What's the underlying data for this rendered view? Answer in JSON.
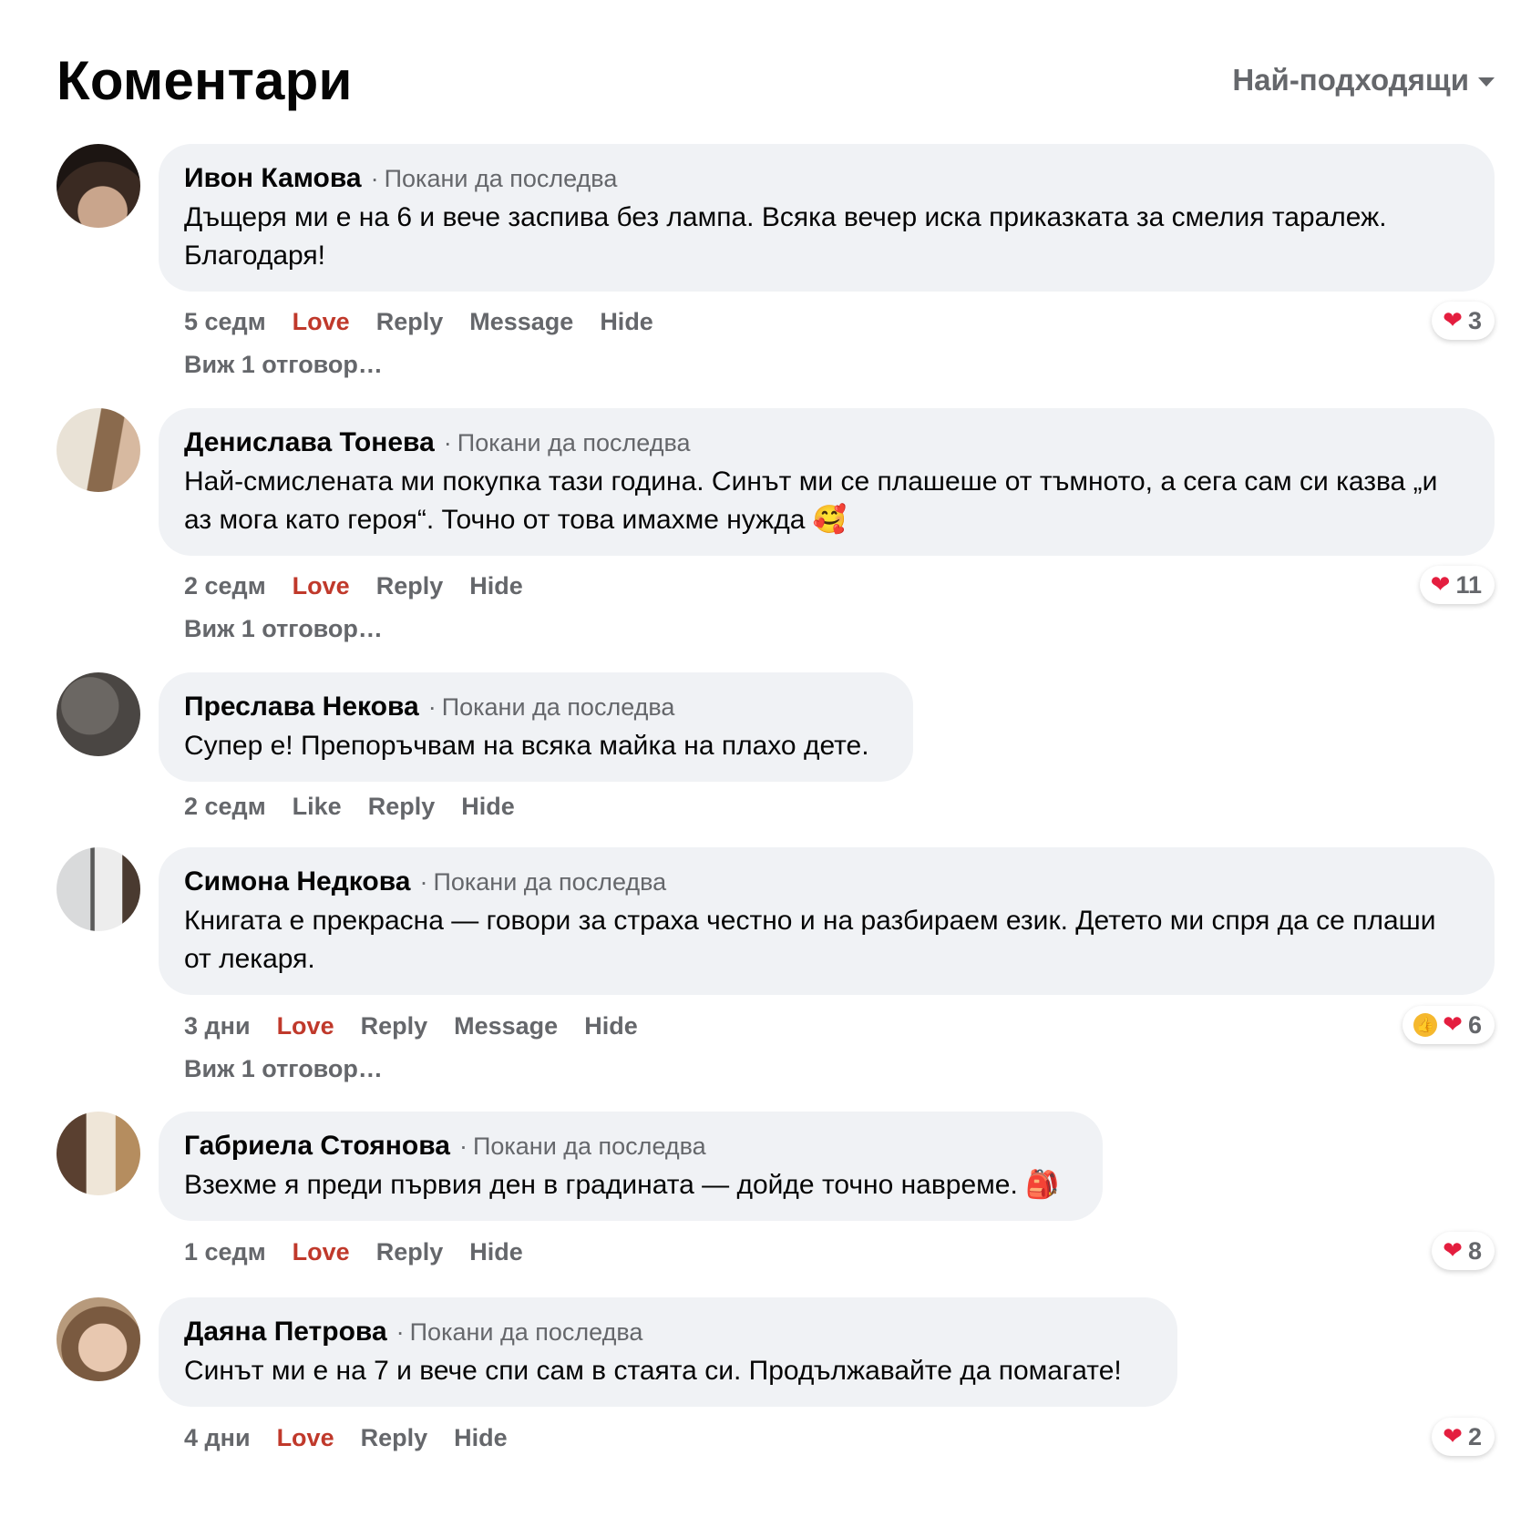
{
  "header": {
    "title": "Коментари",
    "sort_label": "Най-подходящи"
  },
  "comments": [
    {
      "name": "Ивон Камова",
      "invite": "Покани да последва",
      "text": "Дъщеря ми е на 6 и вече заспива без лампа. Всяка вечер иска приказката за смелия таралеж. Благодаря!",
      "time": "5 седм",
      "actions": [
        "Love",
        "Reply",
        "Message",
        "Hide"
      ],
      "replies": "Виж 1 отговор…",
      "reaction_count": "3"
    },
    {
      "name": "Денислава Тонева",
      "invite": "Покани да последва",
      "text": "Най-смислената ми покупка тази година. Синът ми се плашеше от тъмното, а сега сам си казва „и аз мога като героя“. Точно от това имахме нужда",
      "emoji": "🥰",
      "time": "2 седм",
      "actions": [
        "Love",
        "Reply",
        "Hide"
      ],
      "replies": "Виж 1 отговор…",
      "reaction_count": "11"
    },
    {
      "name": "Преслава Некова",
      "invite": "Покани да последва",
      "text": "Супер е! Препоръчвам на всяка майка на плахо дете.",
      "time": "2 седм",
      "actions": [
        "Like",
        "Reply",
        "Hide"
      ]
    },
    {
      "name": "Симона Недкова",
      "invite": "Покани да последва",
      "text": "Книгата е прекрасна — говори за страха честно и на разбираем език. Детето ми спря да се плаши от лекаря.",
      "time": "3 дни",
      "actions": [
        "Love",
        "Reply",
        "Message",
        "Hide"
      ],
      "replies": "Виж 1 отговор…",
      "reaction_count": "6"
    },
    {
      "name": "Габриела Стоянова",
      "invite": "Покани да последва",
      "text": "Взехме я преди първия ден в градината — дойде точно навреме.",
      "emoji": "🎒",
      "time": "1 седм",
      "actions": [
        "Love",
        "Reply",
        "Hide"
      ],
      "reaction_count": "8"
    },
    {
      "name": "Даяна Петрова",
      "invite": "Покани да последва",
      "text": "Синът ми е на 7 и вече спи сам в стаята си. Продължавайте да помагате!",
      "time": "4 дни",
      "actions": [
        "Love",
        "Reply",
        "Hide"
      ],
      "reaction_count": "2"
    }
  ],
  "colors": {
    "bubble": "#f0f2f5",
    "muted": "#65676b",
    "love": "#c0392b",
    "heart": "#e41e3f"
  },
  "icons": {
    "sort": "chevron-down-icon",
    "heart": "heart-icon",
    "like": "thumbs-up-icon"
  }
}
